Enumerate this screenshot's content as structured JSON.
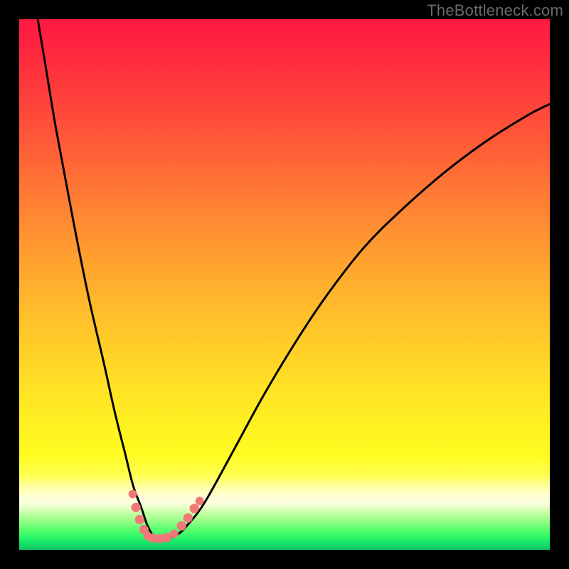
{
  "watermark": "TheBottleneck.com",
  "chart_data": {
    "type": "line",
    "title": "",
    "xlabel": "",
    "ylabel": "",
    "x_range": [
      0,
      100
    ],
    "y_range": [
      0,
      100
    ],
    "series": [
      {
        "name": "bottleneck-curve",
        "x": [
          3.5,
          5,
          7,
          10,
          13,
          16,
          18,
          20,
          21.5,
          23,
          24,
          25,
          26,
          27,
          28,
          30,
          32,
          35,
          40,
          46,
          52,
          58,
          65,
          72,
          80,
          88,
          96,
          100
        ],
        "y": [
          100,
          91,
          79,
          63,
          48,
          35,
          26,
          18,
          12,
          8,
          5,
          3,
          2.2,
          2.0,
          2.2,
          3,
          5,
          9,
          18,
          29,
          39,
          48,
          57,
          64,
          71,
          77,
          82,
          84
        ]
      }
    ],
    "markers": [
      {
        "name": "left-dot-1",
        "x": 21.4,
        "y": 10.5,
        "r": 1.0
      },
      {
        "name": "left-dot-2",
        "x": 22.0,
        "y": 8.0,
        "r": 1.2
      },
      {
        "name": "left-dot-3",
        "x": 22.7,
        "y": 5.7,
        "r": 1.2
      },
      {
        "name": "left-dot-4",
        "x": 23.5,
        "y": 3.8,
        "r": 1.2
      },
      {
        "name": "left-dot-5",
        "x": 24.2,
        "y": 2.6,
        "r": 1.0
      },
      {
        "name": "mid-dot-1",
        "x": 25.2,
        "y": 2.2,
        "r": 1.2
      },
      {
        "name": "mid-dot-2",
        "x": 26.5,
        "y": 2.1,
        "r": 1.2
      },
      {
        "name": "mid-dot-3",
        "x": 27.8,
        "y": 2.3,
        "r": 1.2
      },
      {
        "name": "right-dot-1",
        "x": 29.2,
        "y": 3.0,
        "r": 1.0
      },
      {
        "name": "right-dot-2",
        "x": 30.6,
        "y": 4.5,
        "r": 1.2
      },
      {
        "name": "right-dot-3",
        "x": 31.8,
        "y": 6.0,
        "r": 1.2
      },
      {
        "name": "right-dot-4",
        "x": 33.0,
        "y": 7.8,
        "r": 1.2
      },
      {
        "name": "right-dot-5",
        "x": 34.0,
        "y": 9.2,
        "r": 1.0
      }
    ],
    "marker_color": "#f07878",
    "curve_color": "#000000",
    "gradient_stops": [
      {
        "pos": 0.0,
        "color": "#ff1842"
      },
      {
        "pos": 0.5,
        "color": "#ffb828"
      },
      {
        "pos": 0.82,
        "color": "#ffff40"
      },
      {
        "pos": 0.9,
        "color": "#ffffd0"
      },
      {
        "pos": 1.0,
        "color": "#10c868"
      }
    ]
  }
}
